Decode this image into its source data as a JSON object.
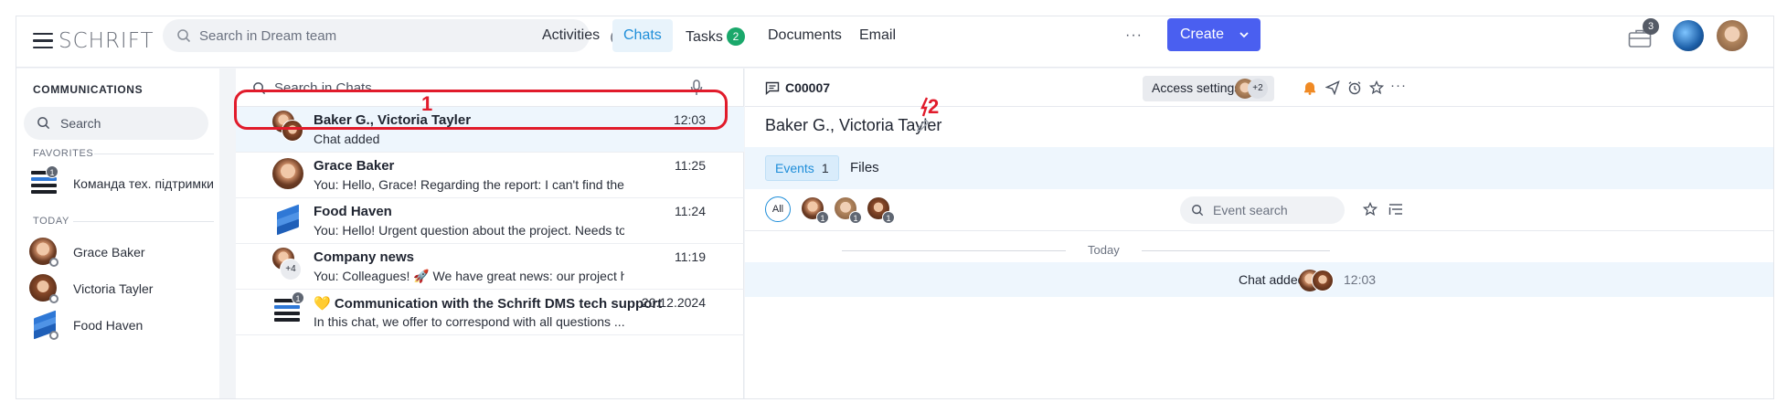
{
  "app": {
    "logo": "SCHRIFT"
  },
  "topbar": {
    "search_placeholder": "Search in Dream team",
    "nav": [
      {
        "label": "Activities"
      },
      {
        "label": "Chats",
        "active": true
      },
      {
        "label": "Tasks",
        "badge": "2"
      },
      {
        "label": "Documents"
      },
      {
        "label": "Email"
      }
    ],
    "more": "···",
    "create_label": "Create",
    "briefcase_badge": "3"
  },
  "sidebar": {
    "heading": "COMMUNICATIONS",
    "search_placeholder": "Search",
    "favorites_label": "FAVORITES",
    "favorites": [
      {
        "label": "Команда тех. підтримки",
        "badge": "1"
      }
    ],
    "today_label": "TODAY",
    "today": [
      {
        "label": "Grace Baker"
      },
      {
        "label": "Victoria Tayler"
      },
      {
        "label": "Food Haven"
      }
    ]
  },
  "chatlist": {
    "search_placeholder": "Search in Chats",
    "chats": [
      {
        "name": "Baker G., Victoria Tayler",
        "snippet": "Chat added",
        "time": "12:03",
        "selected": true
      },
      {
        "name": "Grace Baker",
        "snippet": "You: Hello, Grace! Regarding the report: I can't find the dat...",
        "time": "11:25"
      },
      {
        "name": "Food Haven",
        "snippet": "You: Hello! Urgent question about the project. Needs to be ...",
        "time": "11:24"
      },
      {
        "name": "Company news",
        "snippet": "You: Colleagues! 🚀 We have great news: our project has ...",
        "time": "11:19",
        "extra": "+4"
      },
      {
        "name": "💛 Communication with the Schrift DMS tech support",
        "snippet": "In this chat, we offer to correspond with all questions ...",
        "time": "20.12.2024",
        "badge": "1"
      }
    ]
  },
  "annotations": {
    "one": "1",
    "two": "2"
  },
  "detail": {
    "code": "C00007",
    "access_label": "Access settings",
    "access_extra": "+2",
    "title": "Baker G., Victoria Tayler",
    "tabs": {
      "events": "Events",
      "events_count": "1",
      "files": "Files"
    },
    "filter_all": "All",
    "filter_badges": [
      "1",
      "1",
      "1"
    ],
    "event_search_placeholder": "Event search",
    "today": "Today",
    "event": {
      "text": "Chat added",
      "time": "12:03"
    }
  },
  "colors": {
    "accent": "#1f8ed9",
    "create": "#4a5ff0",
    "tasks_badge": "#1aa86b",
    "annotation": "#e11b2b"
  }
}
